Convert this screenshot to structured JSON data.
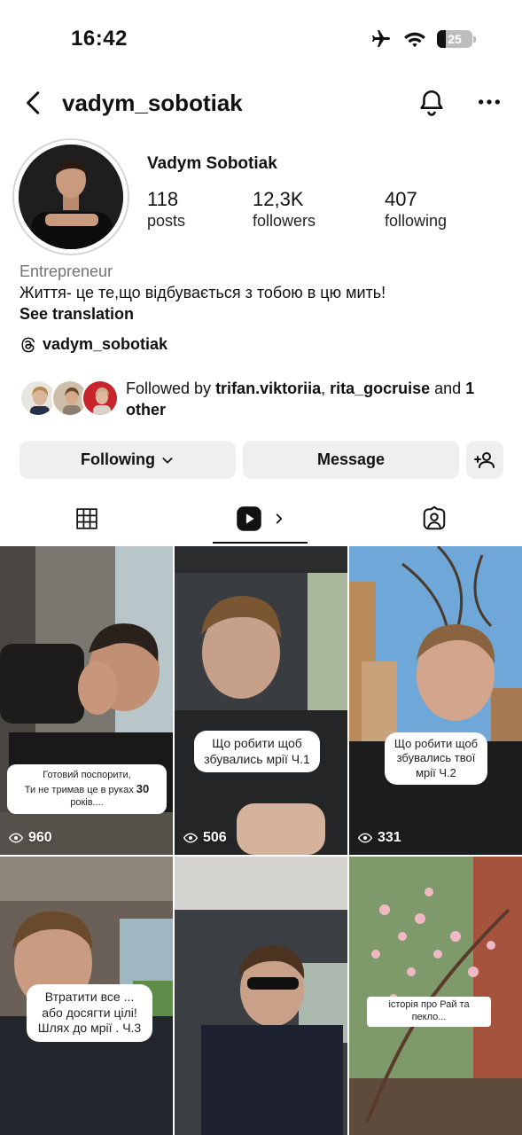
{
  "status_bar": {
    "time": "16:42",
    "battery": "25",
    "battery_level": 0.25
  },
  "header": {
    "username": "vadym_sobotiak"
  },
  "profile": {
    "display_name": "Vadym Sobotiak",
    "stats": [
      {
        "value": "118",
        "label": "posts"
      },
      {
        "value": "12,3K",
        "label": "followers"
      },
      {
        "value": "407",
        "label": "following"
      }
    ],
    "category": "Entrepreneur",
    "bio": "Життя- це те,що відбувається з тобою в цю мить!",
    "see_translation": "See translation",
    "threads_handle": "vadym_sobotiak",
    "followed_by": {
      "prefix": "Followed by ",
      "user1": "trifan.viktoriia",
      "sep": ", ",
      "user2": "rita_gocruise",
      "and": " and ",
      "others": "1 other"
    }
  },
  "actions": {
    "following": "Following",
    "message": "Message"
  },
  "tabs": [
    "grid-icon",
    "reels-icon",
    "tagged-icon"
  ],
  "reels": [
    {
      "caption_line1": "Готовий поспорити,",
      "caption_line2": "Ти не тримав це в руках ",
      "caption_bold": "30",
      "caption_line2_end": " років....",
      "views": "960"
    },
    {
      "caption": "Що робити щоб збувались мрії Ч.1",
      "views": "506"
    },
    {
      "caption": "Що робити щоб збувались твої мрії Ч.2",
      "views": "331"
    },
    {
      "caption": "Втратити все ... або досягти цілі! Шлях до мрії . Ч.3",
      "views": ""
    },
    {
      "caption": "",
      "views": ""
    },
    {
      "caption": "історія про Рай та пекло...",
      "views": ""
    }
  ],
  "colors": {
    "button_bg": "#efefef",
    "muted_text": "#737373",
    "accent": "#111111"
  }
}
